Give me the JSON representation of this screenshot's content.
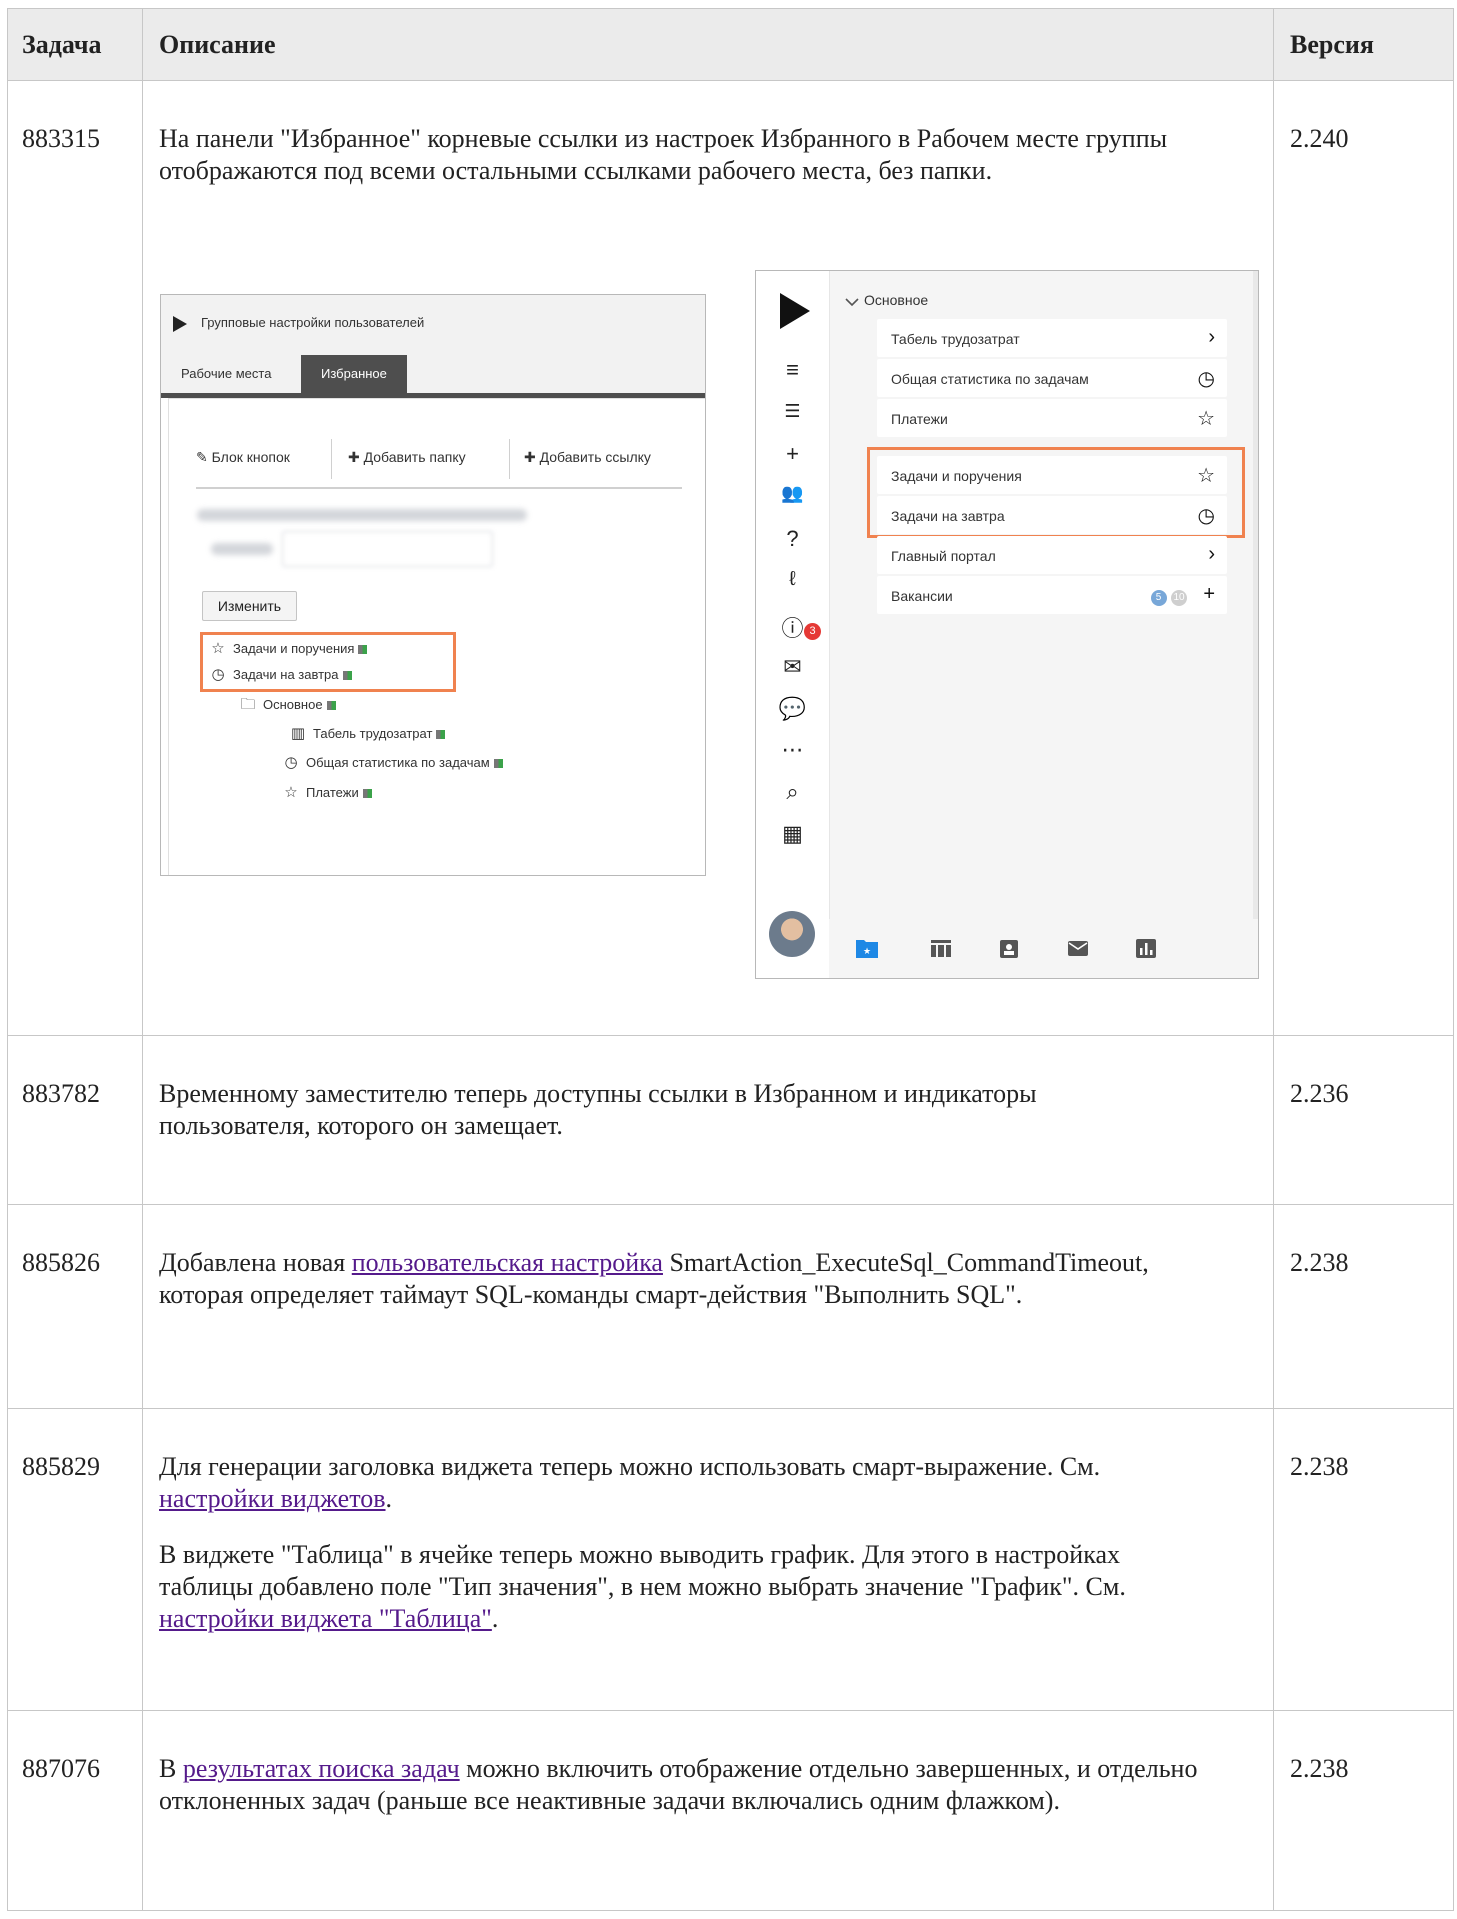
{
  "columns": {
    "task": "Задача",
    "description": "Описание",
    "version": "Версия"
  },
  "rows": [
    {
      "id": "883315",
      "text": "На панели \"Избранное\" корневые ссылки из настроек Избранного в Рабочем месте группы отображаются под всеми остальными ссылками рабочего места, без папки.",
      "version": "2.240"
    },
    {
      "id": "883782",
      "text": "Временному заместителю теперь доступны ссылки в Избранном и индикаторы пользователя, которого он замещает.",
      "version": "2.236"
    },
    {
      "id": "885826",
      "prefix": "Добавлена новая ",
      "link": "пользовательская настройка",
      "suffix": " SmartAction_ExecuteSql_CommandTimeout, которая определяет таймаут SQL-команды смарт-действия \"Выполнить SQL\".",
      "version": "2.238"
    },
    {
      "id": "885829",
      "p1_prefix": "Для генерации заголовка виджета теперь можно использовать смарт-выражение. См. ",
      "p1_link": "настройки виджетов",
      "p1_suffix": ".",
      "p2_prefix": "В виджете \"Таблица\" в ячейке теперь можно выводить график. Для этого в настройках таблицы добавлено поле \"Тип значения\", в нем можно выбрать значение \"График\". См. ",
      "p2_link": "настройки виджета \"Таблица\"",
      "p2_suffix": ".",
      "version": "2.238"
    },
    {
      "id": "887076",
      "prefix": "В ",
      "link": "результатах поиска задач",
      "suffix": " можно включить отображение отдельно завершенных, и отдельно отклоненных задач (раньше все неактивные задачи включались одним флажком).",
      "version": "2.238"
    }
  ],
  "screenshot_group_settings": {
    "title": "Групповые настройки пользователей",
    "tabs": [
      "Рабочие места",
      "Избранное"
    ],
    "toolbar": [
      "Блок кнопок",
      "Добавить папку",
      "Добавить ссылку"
    ],
    "change_button": "Изменить",
    "tree": [
      {
        "icon": "star-icon",
        "label": "Задачи и поручения"
      },
      {
        "icon": "clock-icon",
        "label": "Задачи на завтра"
      },
      {
        "icon": "folder-icon",
        "label": "Основное"
      },
      {
        "icon": "table-icon",
        "label": "Табель трудозатрат"
      },
      {
        "icon": "clock-icon",
        "label": "Общая статистика по задачам"
      },
      {
        "icon": "star-icon",
        "label": "Платежи"
      }
    ]
  },
  "screenshot_favorites_panel": {
    "section": "Основное",
    "items": [
      {
        "label": "Табель трудозатрат",
        "icon": "chevron-right-icon"
      },
      {
        "label": "Общая статистика по задачам",
        "icon": "clock-icon"
      },
      {
        "label": "Платежи",
        "icon": "star-icon"
      },
      {
        "label": "Задачи и поручения",
        "icon": "star-icon"
      },
      {
        "label": "Задачи на завтра",
        "icon": "clock-icon"
      },
      {
        "label": "Главный портал",
        "icon": "chevron-right-icon"
      },
      {
        "label": "Вакансии",
        "icon": "plus-icon",
        "counter_a": "5",
        "counter_b": "10"
      }
    ],
    "notification_badge": "3",
    "accent_color": "#f0824f"
  }
}
